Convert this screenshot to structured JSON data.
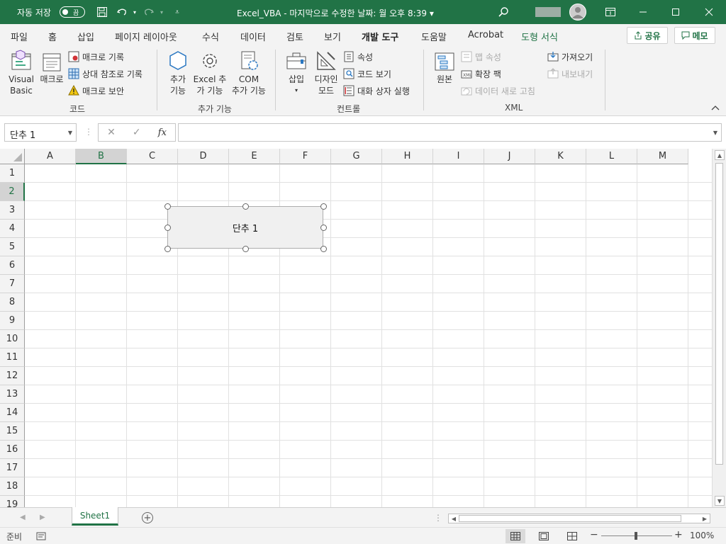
{
  "titlebar": {
    "autosave_label": "자동 저장",
    "autosave_state": "끔",
    "title": "Excel_VBA - 마지막으로 수정한 날짜: 월 오후 8:39",
    "title_dropdown": "▾",
    "search_icon": "search-icon",
    "colors": {
      "brand": "#217346"
    }
  },
  "tabs": [
    {
      "label": "파일"
    },
    {
      "label": "홈"
    },
    {
      "label": "삽입"
    },
    {
      "label": "페이지 레이아웃"
    },
    {
      "label": "수식"
    },
    {
      "label": "데이터"
    },
    {
      "label": "검토"
    },
    {
      "label": "보기"
    },
    {
      "label": "개발 도구",
      "active": true
    },
    {
      "label": "도움말"
    },
    {
      "label": "Acrobat"
    },
    {
      "label": "도형 서식",
      "contextual": true
    }
  ],
  "share": {
    "share_label": "공유",
    "comment_label": "메모"
  },
  "ribbon": {
    "code": {
      "group_label": "코드",
      "visual_basic_line1": "Visual",
      "visual_basic_line2": "Basic",
      "macro": "매크로",
      "record_macro": "매크로 기록",
      "relative_refs": "상대 참조로 기록",
      "macro_security": "매크로 보안"
    },
    "addins": {
      "group_label": "추가 기능",
      "addins_line1": "추가",
      "addins_line2": "기능",
      "excel_addins_line1": "Excel 추",
      "excel_addins_line2": "가 기능",
      "com_addins_line1": "COM",
      "com_addins_line2": "추가 기능"
    },
    "controls": {
      "group_label": "컨트롤",
      "insert": "삽입",
      "design_mode_line1": "디자인",
      "design_mode_line2": "모드",
      "properties": "속성",
      "view_code": "코드 보기",
      "run_dialog": "대화 상자 실행"
    },
    "xml": {
      "group_label": "XML",
      "source": "원본",
      "map_properties": "맵 속성",
      "expansion_packs": "확장 팩",
      "refresh_data": "데이터 새로 고침",
      "import": "가져오기",
      "export": "내보내기"
    }
  },
  "formula": {
    "namebox": "단추 1",
    "fx": "fx",
    "cancel": "✕",
    "enter": "✓",
    "content": ""
  },
  "sheet": {
    "columns": [
      "A",
      "B",
      "C",
      "D",
      "E",
      "F",
      "G",
      "H",
      "I",
      "J",
      "K",
      "L",
      "M"
    ],
    "rows": [
      "1",
      "2",
      "3",
      "4",
      "5",
      "6",
      "7",
      "8",
      "9",
      "10",
      "11",
      "12",
      "13",
      "14",
      "15",
      "16",
      "17",
      "18",
      "19"
    ],
    "selected_column": "B",
    "selected_row": "2",
    "form_button_label": "단추 1"
  },
  "sheettabs": {
    "active_sheet": "Sheet1",
    "add": "+"
  },
  "status": {
    "ready": "준비",
    "zoom": "100%",
    "zoom_minus": "−",
    "zoom_plus": "+"
  }
}
